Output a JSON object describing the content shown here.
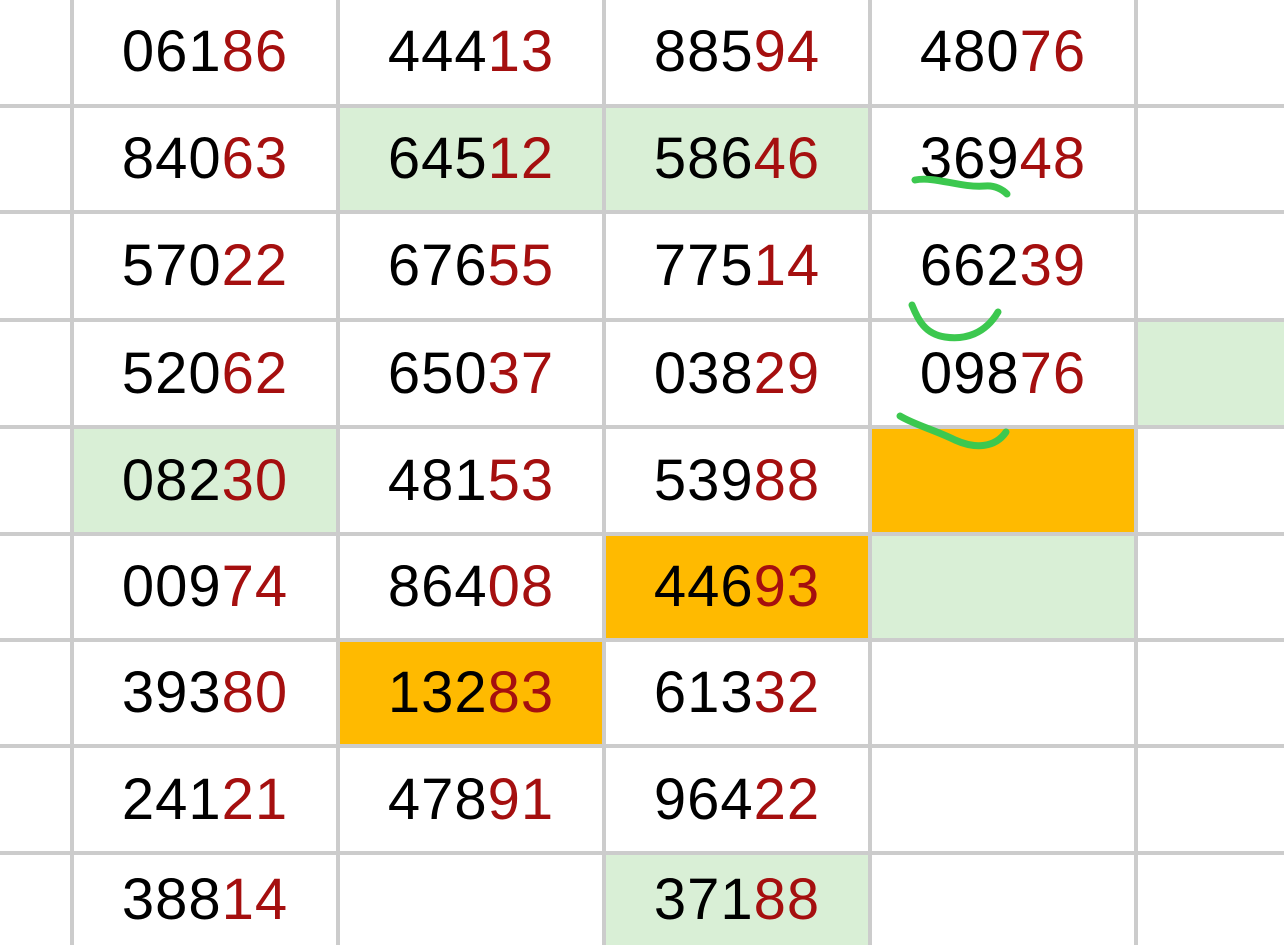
{
  "colors": {
    "grid_line": "#cccccc",
    "lead_digits": "#000000",
    "tail_digits": "#a50f0f",
    "highlight_green": "#d9efd6",
    "highlight_orange": "#ffba00",
    "pen_marks": "#3cc84f"
  },
  "table": {
    "columns": [
      {
        "cells": [
          {
            "lead": "061",
            "tail": "86",
            "fill": "none"
          },
          {
            "lead": "840",
            "tail": "63",
            "fill": "none"
          },
          {
            "lead": "570",
            "tail": "22",
            "fill": "none"
          },
          {
            "lead": "520",
            "tail": "62",
            "fill": "none"
          },
          {
            "lead": "082",
            "tail": "30",
            "fill": "green"
          },
          {
            "lead": "009",
            "tail": "74",
            "fill": "none"
          },
          {
            "lead": "393",
            "tail": "80",
            "fill": "none"
          },
          {
            "lead": "241",
            "tail": "21",
            "fill": "none"
          },
          {
            "lead": "388",
            "tail": "14",
            "fill": "none"
          }
        ]
      },
      {
        "cells": [
          {
            "lead": "444",
            "tail": "13",
            "fill": "none"
          },
          {
            "lead": "645",
            "tail": "12",
            "fill": "green"
          },
          {
            "lead": "676",
            "tail": "55",
            "fill": "none"
          },
          {
            "lead": "650",
            "tail": "37",
            "fill": "none"
          },
          {
            "lead": "481",
            "tail": "53",
            "fill": "none"
          },
          {
            "lead": "864",
            "tail": "08",
            "fill": "none"
          },
          {
            "lead": "132",
            "tail": "83",
            "fill": "orange"
          },
          {
            "lead": "478",
            "tail": "91",
            "fill": "none"
          },
          {
            "lead": "",
            "tail": "",
            "fill": "none"
          }
        ]
      },
      {
        "cells": [
          {
            "lead": "885",
            "tail": "94",
            "fill": "none"
          },
          {
            "lead": "586",
            "tail": "46",
            "fill": "green"
          },
          {
            "lead": "775",
            "tail": "14",
            "fill": "none"
          },
          {
            "lead": "038",
            "tail": "29",
            "fill": "none"
          },
          {
            "lead": "539",
            "tail": "88",
            "fill": "none"
          },
          {
            "lead": "446",
            "tail": "93",
            "fill": "orange"
          },
          {
            "lead": "613",
            "tail": "32",
            "fill": "none"
          },
          {
            "lead": "964",
            "tail": "22",
            "fill": "none"
          },
          {
            "lead": "371",
            "tail": "88",
            "fill": "green"
          }
        ]
      },
      {
        "cells": [
          {
            "lead": "480",
            "tail": "76",
            "fill": "none"
          },
          {
            "lead": "369",
            "tail": "48",
            "fill": "none"
          },
          {
            "lead": "662",
            "tail": "39",
            "fill": "none"
          },
          {
            "lead": "098",
            "tail": "76",
            "fill": "none"
          },
          {
            "lead": "",
            "tail": "",
            "fill": "orange"
          },
          {
            "lead": "",
            "tail": "",
            "fill": "green"
          },
          {
            "lead": "",
            "tail": "",
            "fill": "none"
          },
          {
            "lead": "",
            "tail": "",
            "fill": "none"
          },
          {
            "lead": "",
            "tail": "",
            "fill": "none"
          }
        ]
      },
      {
        "cells": [
          {
            "lead": "",
            "tail": "",
            "fill": "none"
          },
          {
            "lead": "",
            "tail": "",
            "fill": "none"
          },
          {
            "lead": "",
            "tail": "",
            "fill": "none"
          },
          {
            "lead": "",
            "tail": "",
            "fill": "green"
          },
          {
            "lead": "",
            "tail": "",
            "fill": "none"
          },
          {
            "lead": "",
            "tail": "",
            "fill": "none"
          },
          {
            "lead": "",
            "tail": "",
            "fill": "none"
          },
          {
            "lead": "",
            "tail": "",
            "fill": "none"
          },
          {
            "lead": "",
            "tail": "",
            "fill": "none"
          }
        ]
      }
    ]
  }
}
